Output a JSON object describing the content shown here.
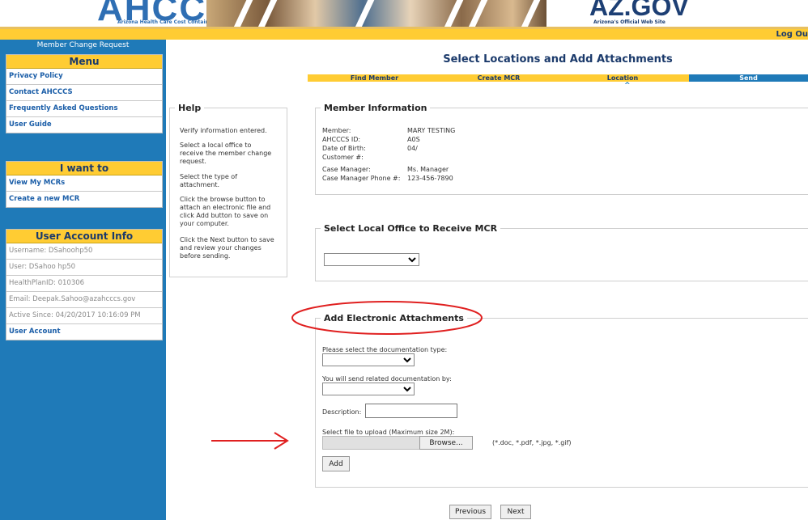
{
  "header": {
    "logo_text": "AHCCCS",
    "logo_subtitle": "Arizona Health Care Cost Containment System",
    "az_logo": "AZ.GOV",
    "az_subtitle": "Arizona's Official Web Site",
    "logout": "Log Ou"
  },
  "sidebar": {
    "title": "Member Change Request",
    "menu": {
      "heading": "Menu",
      "items": [
        {
          "label": "Privacy Policy"
        },
        {
          "label": "Contact AHCCCS"
        },
        {
          "label": "Frequently Asked Questions"
        },
        {
          "label": "User Guide"
        }
      ]
    },
    "want": {
      "heading": "I want to",
      "items": [
        {
          "label": "View My MCRs"
        },
        {
          "label": "Create a new MCR"
        }
      ]
    },
    "account": {
      "heading": "User Account Info",
      "items": [
        {
          "label": "Username: DSahoohp50"
        },
        {
          "label": "User: DSahoo hp50"
        },
        {
          "label": "HealthPlanID: 010306"
        },
        {
          "label": "Email: Deepak.Sahoo@azahcccs.gov"
        },
        {
          "label": "Active Since: 04/20/2017 10:16:09 PM"
        },
        {
          "label": "User Account"
        }
      ]
    }
  },
  "main": {
    "title": "Select Locations and Add Attachments",
    "steps": [
      {
        "label": "Find Member"
      },
      {
        "label": "Create MCR"
      },
      {
        "label": "Location"
      },
      {
        "label": "Send"
      }
    ],
    "caret": "^",
    "help": {
      "legend": "Help",
      "paragraphs": [
        "Verify information entered.",
        "Select a local office to receive the member change request.",
        "Select the type of attachment.",
        "Click the browse button to attach an electronic file  and click Add button to save on your computer.",
        "Click the Next button to save and review your changes before sending."
      ]
    },
    "member": {
      "legend": "Member Information",
      "rows": [
        {
          "label": "Member:",
          "value": "MARY TESTING"
        },
        {
          "label": "AHCCCS ID:",
          "value": "A0S"
        },
        {
          "label": "Date of Birth:",
          "value": "04/"
        },
        {
          "label": "Customer #:",
          "value": ""
        },
        {
          "label": "Case Manager:",
          "value": "Ms. Manager"
        },
        {
          "label": "Case Manager Phone #:",
          "value": "123-456-7890"
        }
      ]
    },
    "office": {
      "legend": "Select Local Office to Receive MCR",
      "selected": ""
    },
    "attachments": {
      "legend": "Add Electronic Attachments",
      "doc_type_label": "Please select the documentation type:",
      "doc_type_selected": "",
      "send_by_label": "You will send related documentation by:",
      "send_by_selected": "",
      "description_label": "Description:",
      "description_value": "",
      "file_label": "Select file to upload (Maximum size 2M):",
      "browse_label": "Browse...",
      "file_types": "(*.doc, *.pdf, *.jpg, *.gif)",
      "add_label": "Add"
    },
    "previous_label": "Previous",
    "next_label": "Next"
  },
  "colors": {
    "sidebar_blue": "#1f7ab8",
    "menu_gold": "#ffcc33",
    "annotation_red": "#e02020",
    "title_navy": "#1b3a6b"
  }
}
